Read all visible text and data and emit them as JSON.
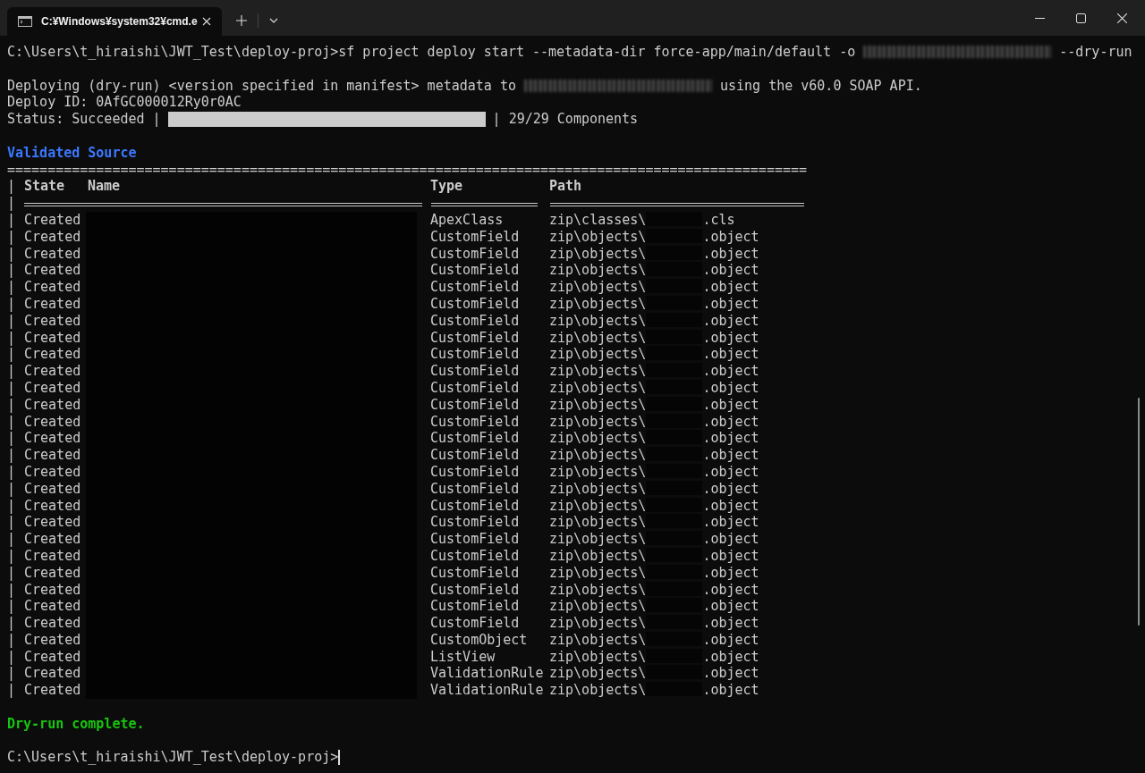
{
  "window": {
    "tab_title": "C:¥Windows¥system32¥cmd.e"
  },
  "command": {
    "before_redaction": "C:\\Users\\t_hiraishi\\JWT_Test\\deploy-proj>sf project deploy start --metadata-dir force-app/main/default -o",
    "after_redaction": "--dry-run"
  },
  "deploying": {
    "before_redaction": "Deploying (dry-run) <version specified in manifest> metadata to",
    "after_redaction": "using the v60.0 SOAP API."
  },
  "deploy_id": "Deploy ID: 0AfGC000012Ry0r0AC",
  "status": {
    "label": "Status: Succeeded |",
    "level": 1,
    "after": "| 29/29 Components"
  },
  "section_title": "Validated Source",
  "rule": "===================================================================================================",
  "table": {
    "header": {
      "lead": "|",
      "columns": [
        "State",
        "Name",
        "Type",
        "Path"
      ]
    },
    "underline_lead": "|",
    "rows": [
      {
        "lead": "|",
        "state": "Created",
        "type": "ApexClass",
        "path_prefix": "zip\\classes\\",
        "path_suffix": ".cls"
      },
      {
        "lead": "|",
        "state": "Created",
        "type": "CustomField",
        "path_prefix": "zip\\objects\\",
        "path_suffix": ".object"
      },
      {
        "lead": "|",
        "state": "Created",
        "type": "CustomField",
        "path_prefix": "zip\\objects\\",
        "path_suffix": ".object"
      },
      {
        "lead": "|",
        "state": "Created",
        "type": "CustomField",
        "path_prefix": "zip\\objects\\",
        "path_suffix": ".object"
      },
      {
        "lead": "|",
        "state": "Created",
        "type": "CustomField",
        "path_prefix": "zip\\objects\\",
        "path_suffix": ".object"
      },
      {
        "lead": "|",
        "state": "Created",
        "type": "CustomField",
        "path_prefix": "zip\\objects\\",
        "path_suffix": ".object"
      },
      {
        "lead": "|",
        "state": "Created",
        "type": "CustomField",
        "path_prefix": "zip\\objects\\",
        "path_suffix": ".object"
      },
      {
        "lead": "|",
        "state": "Created",
        "type": "CustomField",
        "path_prefix": "zip\\objects\\",
        "path_suffix": ".object"
      },
      {
        "lead": "|",
        "state": "Created",
        "type": "CustomField",
        "path_prefix": "zip\\objects\\",
        "path_suffix": ".object"
      },
      {
        "lead": "|",
        "state": "Created",
        "type": "CustomField",
        "path_prefix": "zip\\objects\\",
        "path_suffix": ".object"
      },
      {
        "lead": "|",
        "state": "Created",
        "type": "CustomField",
        "path_prefix": "zip\\objects\\",
        "path_suffix": ".object"
      },
      {
        "lead": "|",
        "state": "Created",
        "type": "CustomField",
        "path_prefix": "zip\\objects\\",
        "path_suffix": ".object"
      },
      {
        "lead": "|",
        "state": "Created",
        "type": "CustomField",
        "path_prefix": "zip\\objects\\",
        "path_suffix": ".object"
      },
      {
        "lead": "|",
        "state": "Created",
        "type": "CustomField",
        "path_prefix": "zip\\objects\\",
        "path_suffix": ".object"
      },
      {
        "lead": "|",
        "state": "Created",
        "type": "CustomField",
        "path_prefix": "zip\\objects\\",
        "path_suffix": ".object"
      },
      {
        "lead": "|",
        "state": "Created",
        "type": "CustomField",
        "path_prefix": "zip\\objects\\",
        "path_suffix": ".object"
      },
      {
        "lead": "|",
        "state": "Created",
        "type": "CustomField",
        "path_prefix": "zip\\objects\\",
        "path_suffix": ".object"
      },
      {
        "lead": "|",
        "state": "Created",
        "type": "CustomField",
        "path_prefix": "zip\\objects\\",
        "path_suffix": ".object"
      },
      {
        "lead": "|",
        "state": "Created",
        "type": "CustomField",
        "path_prefix": "zip\\objects\\",
        "path_suffix": ".object"
      },
      {
        "lead": "|",
        "state": "Created",
        "type": "CustomField",
        "path_prefix": "zip\\objects\\",
        "path_suffix": ".object"
      },
      {
        "lead": "|",
        "state": "Created",
        "type": "CustomField",
        "path_prefix": "zip\\objects\\",
        "path_suffix": ".object"
      },
      {
        "lead": "|",
        "state": "Created",
        "type": "CustomField",
        "path_prefix": "zip\\objects\\",
        "path_suffix": ".object"
      },
      {
        "lead": "|",
        "state": "Created",
        "type": "CustomField",
        "path_prefix": "zip\\objects\\",
        "path_suffix": ".object"
      },
      {
        "lead": "|",
        "state": "Created",
        "type": "CustomField",
        "path_prefix": "zip\\objects\\",
        "path_suffix": ".object"
      },
      {
        "lead": "|",
        "state": "Created",
        "type": "CustomField",
        "path_prefix": "zip\\objects\\",
        "path_suffix": ".object"
      },
      {
        "lead": "|",
        "state": "Created",
        "type": "CustomObject",
        "path_prefix": "zip\\objects\\",
        "path_suffix": ".object"
      },
      {
        "lead": "|",
        "state": "Created",
        "type": "ListView",
        "path_prefix": "zip\\objects\\",
        "path_suffix": ".object"
      },
      {
        "lead": "|",
        "state": "Created",
        "type": "ValidationRule",
        "path_prefix": "zip\\objects\\",
        "path_suffix": ".object"
      },
      {
        "lead": "|",
        "state": "Created",
        "type": "ValidationRule",
        "path_prefix": "zip\\objects\\",
        "path_suffix": ".object"
      }
    ]
  },
  "result": "Dry-run complete.",
  "prompt": "C:\\Users\\t_hiraishi\\JWT_Test\\deploy-proj>"
}
